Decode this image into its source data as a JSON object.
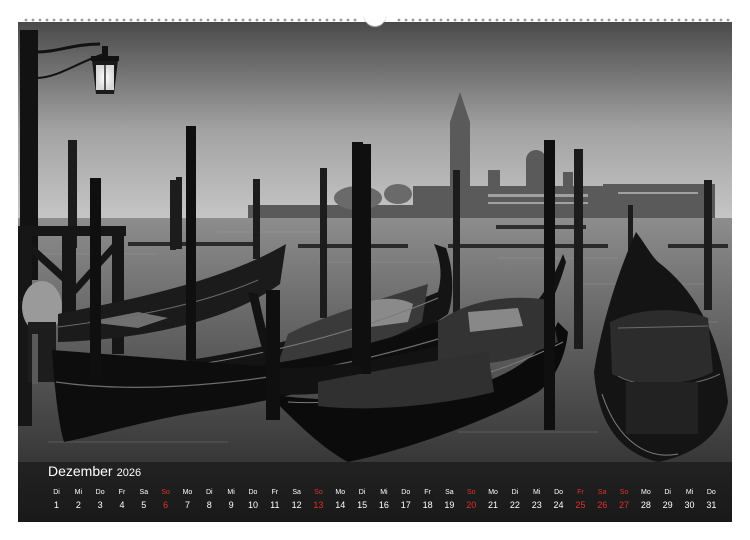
{
  "calendar": {
    "month": "Dezember",
    "year": "2026",
    "days": [
      {
        "wd": "Di",
        "num": "1"
      },
      {
        "wd": "Mi",
        "num": "2"
      },
      {
        "wd": "Do",
        "num": "3"
      },
      {
        "wd": "Fr",
        "num": "4"
      },
      {
        "wd": "Sa",
        "num": "5"
      },
      {
        "wd": "So",
        "num": "6",
        "sun": true
      },
      {
        "wd": "Mo",
        "num": "7"
      },
      {
        "wd": "Di",
        "num": "8"
      },
      {
        "wd": "Mi",
        "num": "9"
      },
      {
        "wd": "Do",
        "num": "10"
      },
      {
        "wd": "Fr",
        "num": "11"
      },
      {
        "wd": "Sa",
        "num": "12"
      },
      {
        "wd": "So",
        "num": "13",
        "sun": true
      },
      {
        "wd": "Mo",
        "num": "14"
      },
      {
        "wd": "Di",
        "num": "15"
      },
      {
        "wd": "Mi",
        "num": "16"
      },
      {
        "wd": "Do",
        "num": "17"
      },
      {
        "wd": "Fr",
        "num": "18"
      },
      {
        "wd": "Sa",
        "num": "19"
      },
      {
        "wd": "So",
        "num": "20",
        "sun": true
      },
      {
        "wd": "Mo",
        "num": "21"
      },
      {
        "wd": "Di",
        "num": "22"
      },
      {
        "wd": "Mi",
        "num": "23"
      },
      {
        "wd": "Do",
        "num": "24"
      },
      {
        "wd": "Fr",
        "num": "25",
        "sun": true
      },
      {
        "wd": "Sa",
        "num": "26",
        "sun": true
      },
      {
        "wd": "So",
        "num": "27",
        "sun": true
      },
      {
        "wd": "Mo",
        "num": "28"
      },
      {
        "wd": "Di",
        "num": "29"
      },
      {
        "wd": "Mi",
        "num": "30"
      },
      {
        "wd": "Do",
        "num": "31"
      }
    ]
  },
  "colors": {
    "weekday_text": "#ffffff",
    "holiday_text": "#e0312b"
  }
}
